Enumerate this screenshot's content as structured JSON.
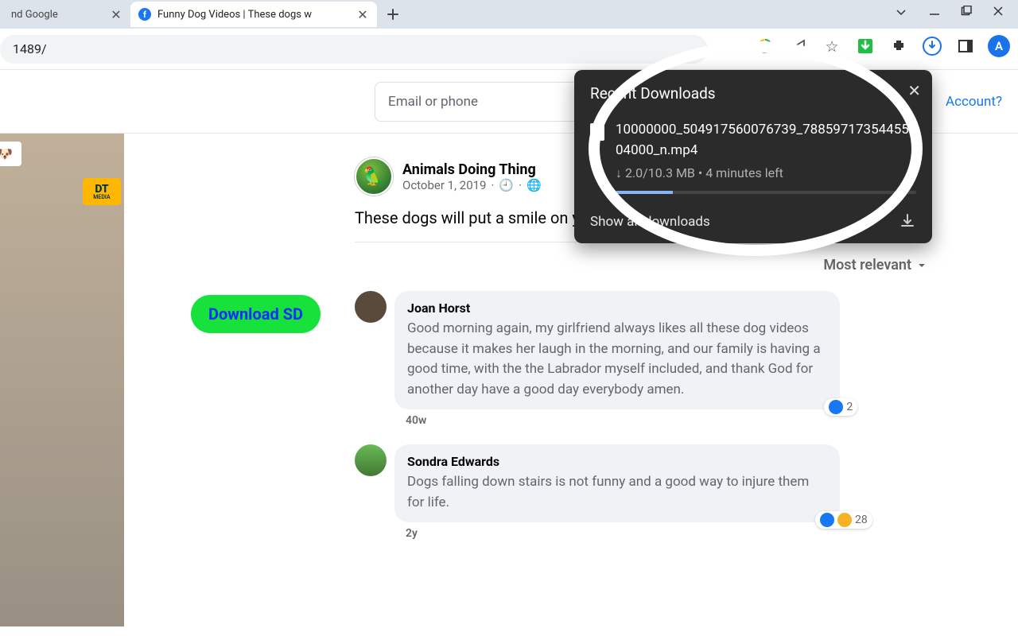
{
  "tabs": {
    "inactive_title": "nd Google",
    "active_title": "Funny Dog Videos | These dogs w"
  },
  "url": "1489/",
  "forgot_account": "Account?",
  "login_placeholder": "Email or phone",
  "download_sd": "Download SD",
  "post": {
    "author": "Animals Doing Thing",
    "date": "October 1, 2019",
    "body": "These dogs will put a smile on your face 😍"
  },
  "sort": "Most relevant",
  "comments": [
    {
      "name": "Joan Horst",
      "text": "Good morning again, my girlfriend always likes all these dog videos because it makes her laugh in the morning, and our family is having a good time, with the the Labrador myself included, and thank God for another day have a good day everybody amen.",
      "age": "40w",
      "reactions": "2"
    },
    {
      "name": "Sondra Edwards",
      "text": "Dogs falling down stairs is not funny and a good way to injure them for life.",
      "age": "2y",
      "reactions": "28"
    }
  ],
  "downloads": {
    "title": "Recent Downloads",
    "file": "10000000_504917560076739_7885971735445504000_n.mp4",
    "status": "↓ 2.0/10.3 MB • 4 minutes left",
    "showall": "Show all downloads"
  },
  "avatar_letter": "A",
  "video_badge": "VIDEOS 🐶",
  "dt": "DT",
  "dt_sub": "MEDIA"
}
